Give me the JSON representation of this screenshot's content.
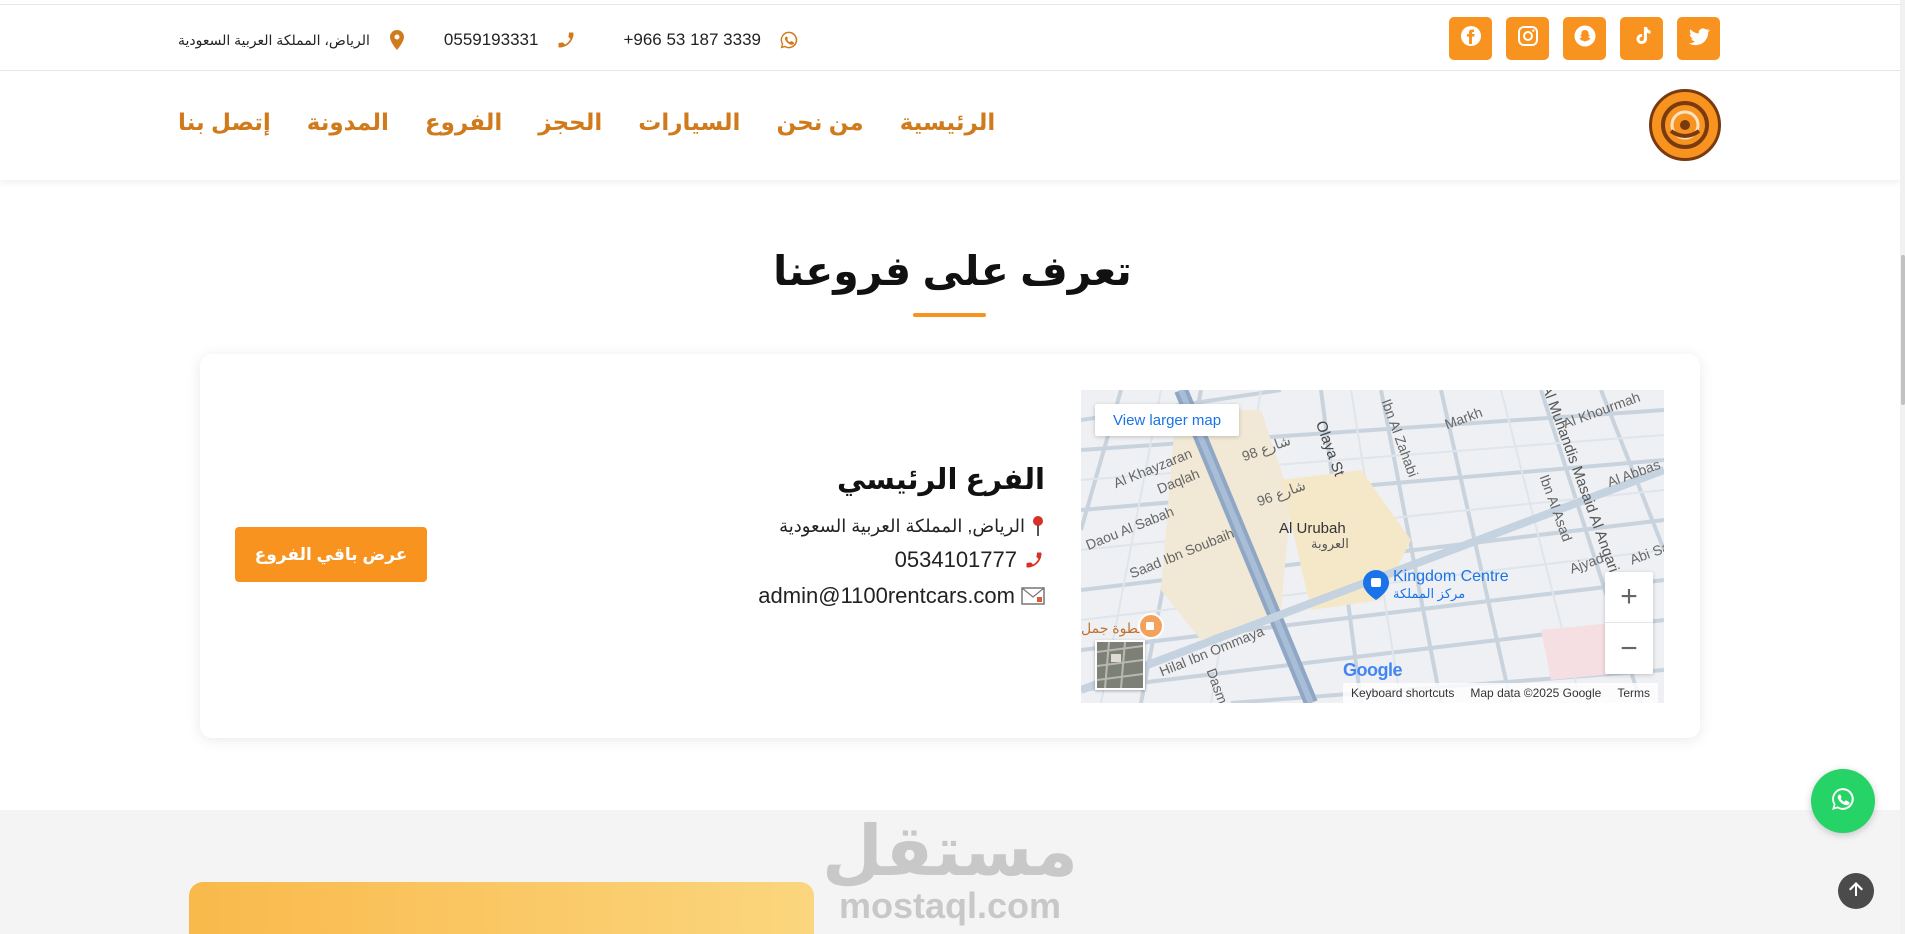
{
  "topbar": {
    "socials": [
      {
        "name": "facebook-icon"
      },
      {
        "name": "instagram-icon"
      },
      {
        "name": "snapchat-icon"
      },
      {
        "name": "tiktok-icon"
      },
      {
        "name": "twitter-icon"
      }
    ],
    "whatsapp_number": "+966 53 187 3339",
    "phone_number": "0559193331",
    "address": "الرياض، المملكة العربية السعودية"
  },
  "nav": {
    "items": [
      "الرئيسية",
      "من نحن",
      "السيارات",
      "الحجز",
      "الفروع",
      "المدونة",
      "إتصل بنا"
    ]
  },
  "section": {
    "title": "تعرف على فروعنا"
  },
  "branch": {
    "name": "الفرع الرئيسي",
    "address": "الرياض, المملكة العربية السعودية",
    "phone": "0534101777",
    "email": "admin@1100rentcars.com",
    "button_label": "عرض باقي الفروع"
  },
  "map": {
    "view_larger": "View larger map",
    "labels": [
      "Al Khayzaran",
      "Daqlah",
      "Daou Al Sabah",
      "Saad Ibn Soubaih",
      "Hilal Ibn Ommaya",
      "Olaya St",
      "Al Urubah",
      "العروبة",
      "Markh",
      "Ibn Al Asad",
      "Al Muhandis Masaid Al Anqari",
      "Al Khourmah",
      "Al Abbas",
      "Ajyad",
      "Ibn Al Zahabi",
      "شارع 98",
      "شارع 96",
      "خطوة جمل",
      "Dasm",
      "Abi Sa"
    ],
    "poi_name": "Kingdom Centre",
    "poi_name_ar": "مركز المملكة",
    "google": "Google",
    "footer": {
      "shortcuts": "Keyboard shortcuts",
      "data": "Map data ©2025 Google",
      "terms": "Terms"
    }
  },
  "watermark": {
    "ar": "مستقل",
    "en": "mostaql.com"
  },
  "colors": {
    "accent": "#f7931e",
    "nav_text": "#d07a1c",
    "whatsapp": "#25d366"
  }
}
